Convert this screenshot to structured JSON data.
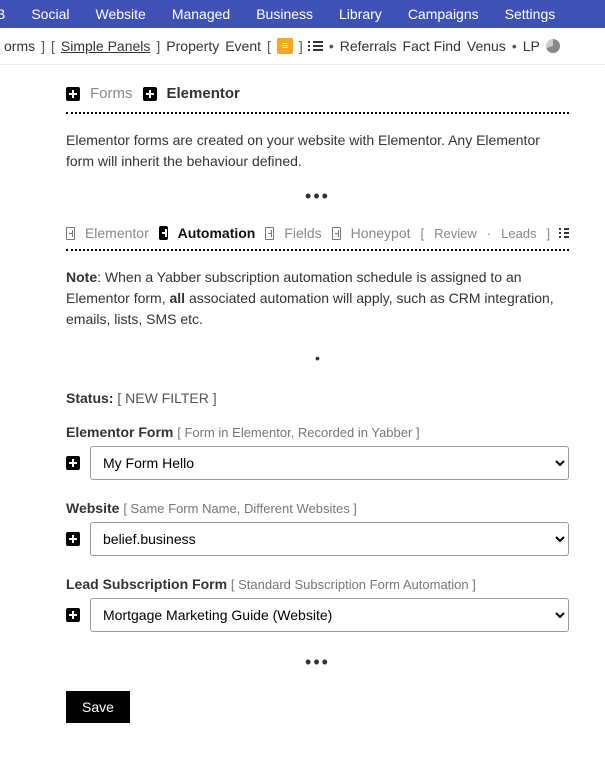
{
  "topnav": {
    "items": [
      "B",
      "Social",
      "Website",
      "Managed",
      "Business",
      "Library",
      "Campaigns",
      "Settings"
    ]
  },
  "subnav": {
    "pre": "orms",
    "simple_panels": "Simple Panels",
    "property": "Property",
    "event": "Event",
    "referrals": "Referrals",
    "fact_find": "Fact Find",
    "venus": "Venus",
    "lp": "LP"
  },
  "panel": {
    "forms_label": "Forms",
    "elementor_label": "Elementor",
    "description": "Elementor forms are created on your website with Elementor. Any Elementor form will inherit the behaviour defined."
  },
  "tabs": {
    "elementor": "Elementor",
    "automation": "Automation",
    "fields": "Fields",
    "honeypot": "Honeypot",
    "review": "Review",
    "leads": "Leads"
  },
  "note": {
    "prefix": "Note",
    "before_bold": ": When a Yabber subscription automation schedule is assigned to an Elementor form, ",
    "bold": "all",
    "after_bold": " associated automation will apply, such as CRM integration, emails, lists, SMS etc."
  },
  "status": {
    "label": "Status:",
    "filter": "[ NEW FILTER ]"
  },
  "fields": {
    "elementor_form": {
      "label": "Elementor Form",
      "hint": "[ Form in Elementor, Recorded in Yabber ]",
      "value": "My Form Hello"
    },
    "website": {
      "label": "Website",
      "hint": "[ Same Form Name, Different Websites ]",
      "value": "belief.business"
    },
    "lead_subscription": {
      "label": "Lead Subscription Form",
      "hint": "[ Standard Subscription Form Automation ]",
      "value": "Mortgage Marketing Guide (Website)"
    }
  },
  "actions": {
    "save": "Save"
  }
}
